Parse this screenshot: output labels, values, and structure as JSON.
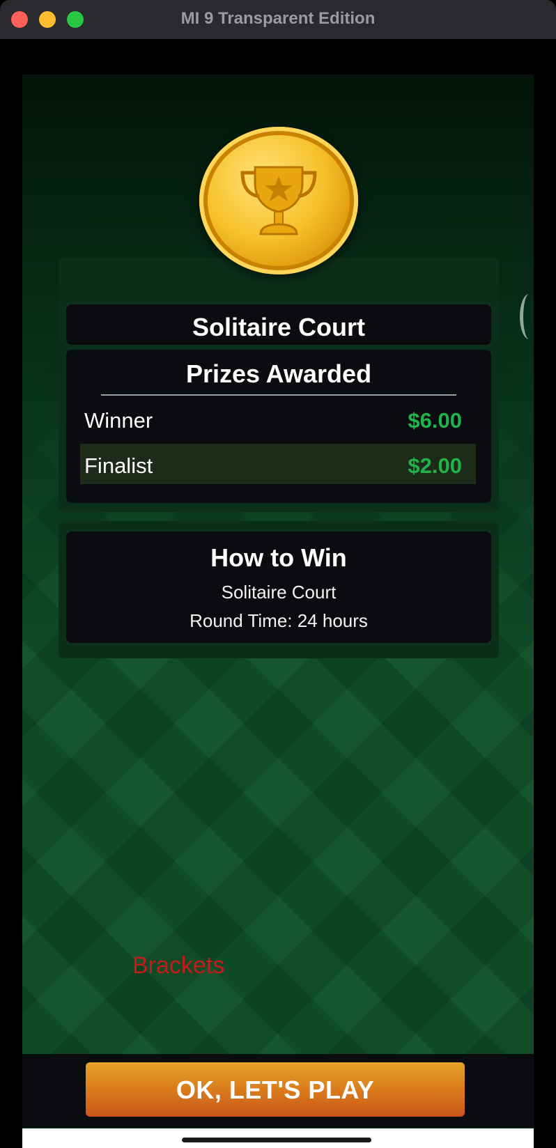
{
  "window": {
    "title": "MI 9 Transparent Edition"
  },
  "trophy": {
    "icon": "trophy-star-icon",
    "colors": {
      "gold": "#f6c12a",
      "gold_dark": "#c98100"
    }
  },
  "tournament": {
    "title": "Solitaire Court"
  },
  "prizes": {
    "heading": "Prizes Awarded",
    "rows": [
      {
        "label": "Winner",
        "amount": "$6.00"
      },
      {
        "label": "Finalist",
        "amount": "$2.00"
      }
    ],
    "amount_color": "#22b24c"
  },
  "how_to_win": {
    "heading": "How to Win",
    "lines": [
      "Solitaire Court",
      "Round Time: 24 hours"
    ]
  },
  "overlay": {
    "brackets_label": "Brackets",
    "brackets_color": "#c71a1a"
  },
  "actions": {
    "play_label": "OK, LET'S PLAY",
    "play_color": "#da7c1c"
  }
}
